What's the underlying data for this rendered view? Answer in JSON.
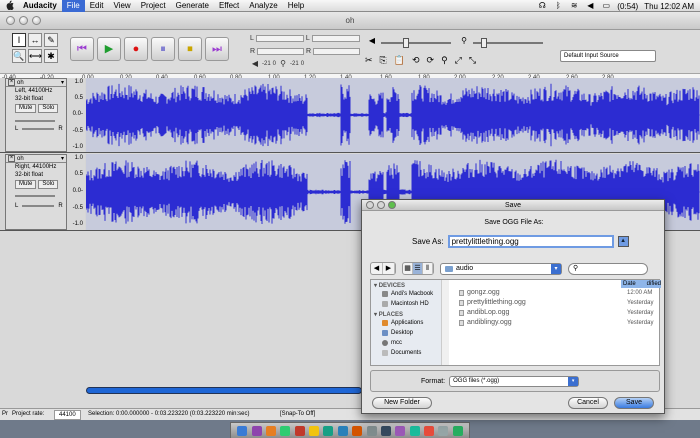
{
  "menubar": {
    "apple": "",
    "items": [
      "Audacity",
      "File",
      "Edit",
      "View",
      "Project",
      "Generate",
      "Effect",
      "Analyze",
      "Help"
    ],
    "active_index": 1,
    "battery": "(0:54)",
    "clock": "Thu 12:02 AM",
    "status_icons": [
      "headphones-icon",
      "bluetooth-icon",
      "wifi-icon",
      "volume-icon",
      "battery-icon"
    ]
  },
  "window": {
    "title": "oh",
    "toolbar": {
      "tools": [
        "I",
        "↔",
        "✎",
        "🔍",
        "⟷",
        "✱"
      ],
      "transport": [
        "⏮",
        "▶",
        "●",
        "⏸",
        "⏹",
        "⏭"
      ],
      "meter_labels": [
        "L",
        "R",
        "L",
        "R"
      ],
      "meter_values": [
        "-21",
        "0",
        "-21",
        "0"
      ],
      "edit_icons": [
        "✂",
        "⎘",
        "📋",
        "⟲",
        "⟳",
        "⚲",
        "⤢",
        "⤡"
      ],
      "input_source": "Default Input Source"
    },
    "ruler": [
      "-0.40",
      "-0.20",
      "0.00",
      "0.20",
      "0.40",
      "0.60",
      "0.80",
      "1.00",
      "1.20",
      "1.40",
      "1.60",
      "1.80",
      "2.00",
      "2.20",
      "2.40",
      "2.60",
      "2.80"
    ],
    "tracks": [
      {
        "name": "oh",
        "channel": "Left, 44100Hz",
        "format": "32-bit float",
        "mute": "Mute",
        "solo": "Solo",
        "scale": [
          "1.0",
          "0.5",
          "0.0-",
          "-0.5",
          "-1.0"
        ],
        "left": "L",
        "right": "R"
      },
      {
        "name": "oh",
        "channel": "Right, 44100Hz",
        "format": "32-bit float",
        "mute": "Mute",
        "solo": "Solo",
        "scale": [
          "1.0",
          "0.5",
          "0.0-",
          "-0.5",
          "-1.0"
        ],
        "left": "L",
        "right": "R"
      }
    ],
    "status": {
      "project_rate_label": "Project rate:",
      "project_rate": "44100",
      "selection": "Selection: 0:00.000000 - 0:03.223220 (0:03.223220 min:sec)",
      "snap": "[Snap-To Off]",
      "pr_prefix": "Pr"
    }
  },
  "dialog": {
    "title": "Save",
    "subtitle": "Save OGG File As:",
    "save_as_label": "Save As:",
    "filename": "prettylittlething.ogg",
    "location": "audio",
    "search_icon": "search-icon",
    "sidebar": {
      "devices_label": "DEVICES",
      "devices": [
        "Andi's Macbook",
        "Macintosh HD"
      ],
      "places_label": "PLACES",
      "places": [
        "Applications",
        "Desktop",
        "mcc",
        "Documents"
      ]
    },
    "date_header": "Date Modified",
    "date_header_short": "Date",
    "date_header_rest": "dified",
    "files": [
      {
        "name": "gongz.ogg",
        "date": "12:00 AM"
      },
      {
        "name": "prettylittlething.ogg",
        "date": "Yesterday"
      },
      {
        "name": "andibLop.ogg",
        "date": "Yesterday"
      },
      {
        "name": "andiblingy.ogg",
        "date": "Yesterday"
      }
    ],
    "format_label": "Format:",
    "format": "OGG files (*.ogg)",
    "new_folder": "New Folder",
    "cancel": "Cancel",
    "save": "Save"
  },
  "dock": {
    "icon_colors": [
      "#3a7bd5",
      "#8e44ad",
      "#e67e22",
      "#2ecc71",
      "#c0392b",
      "#f1c40f",
      "#16a085",
      "#2980b9",
      "#d35400",
      "#7f8c8d",
      "#34495e",
      "#9b59b6",
      "#1abc9c",
      "#e74c3c",
      "#95a5a6",
      "#27ae60"
    ]
  },
  "colors": {
    "wave": "#2c2cd2",
    "wave_bg": "#c7cbdc",
    "selection_blue": "#3a6ad4"
  }
}
